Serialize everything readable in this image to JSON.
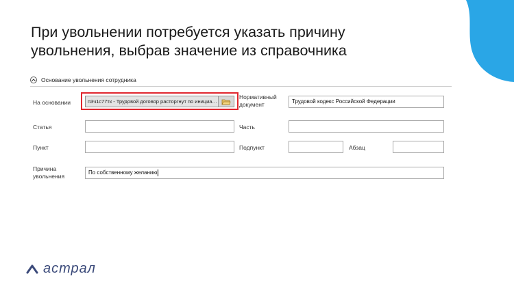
{
  "slide": {
    "title_line1": "При увольнении потребуется указать причину",
    "title_line2": "увольнения, выбрав значение из справочника",
    "accent_color": "#2aa6e6"
  },
  "section": {
    "title": "Основание увольнения сотрудника",
    "collapse_icon": "chevron-up-icon"
  },
  "form": {
    "basis_label": "На основании",
    "basis_value": "п3ч1с77тк - Трудовой договор расторгнут по инициативе...",
    "basis_button_icon": "folder-icon",
    "normative_label_line1": "Нормативный",
    "normative_label_line2": "документ",
    "normative_value": "Трудовой кодекс Российской Федерации",
    "article_label": "Статья",
    "article_value": "",
    "part_label": "Часть",
    "part_value": "",
    "point_label": "Пункт",
    "point_value": "",
    "subpoint_label": "Подпункт",
    "subpoint_value": "",
    "paragraph_label": "Абзац",
    "paragraph_value": "",
    "reason_label_line1": "Причина",
    "reason_label_line2": "увольнения",
    "reason_value": "По собственному желанию"
  },
  "brand": {
    "logo_text": "астрал",
    "highlight_color": "#e0262e"
  }
}
